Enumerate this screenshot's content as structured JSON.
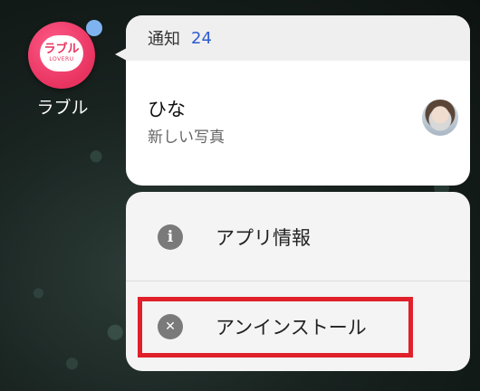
{
  "app": {
    "name": "ラブル",
    "icon_text": "ラブル",
    "icon_subtext": "LOVERU",
    "icon": "app-icon",
    "badge_icon": "notification-dot"
  },
  "notification": {
    "header_label": "通知",
    "count": "24",
    "title": "ひな",
    "text": "新しい写真",
    "avatar_icon": "avatar"
  },
  "menu": {
    "items": [
      {
        "label": "アプリ情報",
        "icon": "info-icon",
        "glyph": "i"
      },
      {
        "label": "アンインストール",
        "icon": "close-circle-icon",
        "glyph": "✕"
      }
    ]
  },
  "colors": {
    "brand": "#e8335f",
    "count": "#2d5bd0",
    "badge": "#7fb3f0",
    "highlight": "#e0202a"
  }
}
